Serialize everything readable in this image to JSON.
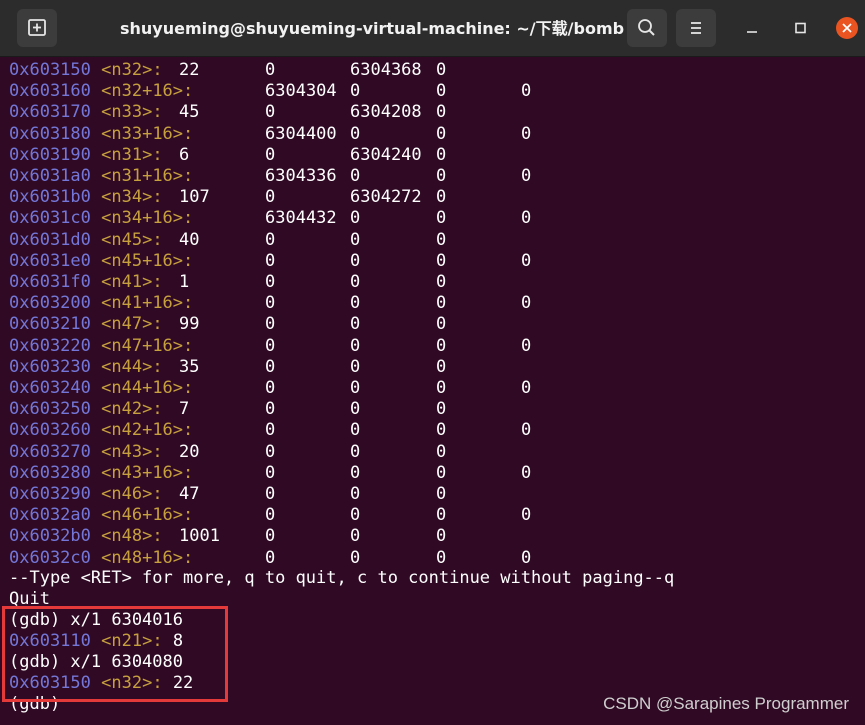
{
  "window": {
    "title": "shuyueming@shuyueming-virtual-machine: ~/下载/bomb",
    "icons": {
      "new_tab": "new-tab-icon",
      "search": "search-icon",
      "menu": "hamburger-menu-icon",
      "minimize": "minimize-icon",
      "maximize": "maximize-icon",
      "close": "close-icon"
    },
    "colors": {
      "background": "#300a24",
      "address": "#7477d9",
      "symbol": "#c7a03e",
      "text": "#ffffff",
      "close_button": "#e95420",
      "highlight_border": "#e43a3a"
    }
  },
  "memory_rows": [
    {
      "addr": "0x603150",
      "sym": "<n32>:",
      "v1": "22",
      "v2": "0",
      "v3": "6304368",
      "v4": "0",
      "v5": ""
    },
    {
      "addr": "0x603160",
      "sym": "<n32+16>:",
      "v1": "",
      "v2": "6304304",
      "v3": "0",
      "v4": "0",
      "v5": "0"
    },
    {
      "addr": "0x603170",
      "sym": "<n33>:",
      "v1": "45",
      "v2": "0",
      "v3": "6304208",
      "v4": "0",
      "v5": ""
    },
    {
      "addr": "0x603180",
      "sym": "<n33+16>:",
      "v1": "",
      "v2": "6304400",
      "v3": "0",
      "v4": "0",
      "v5": "0"
    },
    {
      "addr": "0x603190",
      "sym": "<n31>:",
      "v1": "6",
      "v2": "0",
      "v3": "6304240",
      "v4": "0",
      "v5": ""
    },
    {
      "addr": "0x6031a0",
      "sym": "<n31+16>:",
      "v1": "",
      "v2": "6304336",
      "v3": "0",
      "v4": "0",
      "v5": "0"
    },
    {
      "addr": "0x6031b0",
      "sym": "<n34>:",
      "v1": "107",
      "v2": "0",
      "v3": "6304272",
      "v4": "0",
      "v5": ""
    },
    {
      "addr": "0x6031c0",
      "sym": "<n34+16>:",
      "v1": "",
      "v2": "6304432",
      "v3": "0",
      "v4": "0",
      "v5": "0"
    },
    {
      "addr": "0x6031d0",
      "sym": "<n45>:",
      "v1": "40",
      "v2": "0",
      "v3": "0",
      "v4": "0",
      "v5": ""
    },
    {
      "addr": "0x6031e0",
      "sym": "<n45+16>:",
      "v1": "",
      "v2": "0",
      "v3": "0",
      "v4": "0",
      "v5": "0"
    },
    {
      "addr": "0x6031f0",
      "sym": "<n41>:",
      "v1": "1",
      "v2": "0",
      "v3": "0",
      "v4": "0",
      "v5": ""
    },
    {
      "addr": "0x603200",
      "sym": "<n41+16>:",
      "v1": "",
      "v2": "0",
      "v3": "0",
      "v4": "0",
      "v5": "0"
    },
    {
      "addr": "0x603210",
      "sym": "<n47>:",
      "v1": "99",
      "v2": "0",
      "v3": "0",
      "v4": "0",
      "v5": ""
    },
    {
      "addr": "0x603220",
      "sym": "<n47+16>:",
      "v1": "",
      "v2": "0",
      "v3": "0",
      "v4": "0",
      "v5": "0"
    },
    {
      "addr": "0x603230",
      "sym": "<n44>:",
      "v1": "35",
      "v2": "0",
      "v3": "0",
      "v4": "0",
      "v5": ""
    },
    {
      "addr": "0x603240",
      "sym": "<n44+16>:",
      "v1": "",
      "v2": "0",
      "v3": "0",
      "v4": "0",
      "v5": "0"
    },
    {
      "addr": "0x603250",
      "sym": "<n42>:",
      "v1": "7",
      "v2": "0",
      "v3": "0",
      "v4": "0",
      "v5": ""
    },
    {
      "addr": "0x603260",
      "sym": "<n42+16>:",
      "v1": "",
      "v2": "0",
      "v3": "0",
      "v4": "0",
      "v5": "0"
    },
    {
      "addr": "0x603270",
      "sym": "<n43>:",
      "v1": "20",
      "v2": "0",
      "v3": "0",
      "v4": "0",
      "v5": ""
    },
    {
      "addr": "0x603280",
      "sym": "<n43+16>:",
      "v1": "",
      "v2": "0",
      "v3": "0",
      "v4": "0",
      "v5": "0"
    },
    {
      "addr": "0x603290",
      "sym": "<n46>:",
      "v1": "47",
      "v2": "0",
      "v3": "0",
      "v4": "0",
      "v5": ""
    },
    {
      "addr": "0x6032a0",
      "sym": "<n46+16>:",
      "v1": "",
      "v2": "0",
      "v3": "0",
      "v4": "0",
      "v5": "0"
    },
    {
      "addr": "0x6032b0",
      "sym": "<n48>:",
      "v1": "1001",
      "v2": "0",
      "v3": "0",
      "v4": "0",
      "v5": ""
    },
    {
      "addr": "0x6032c0",
      "sym": "<n48+16>:",
      "v1": "",
      "v2": "0",
      "v3": "0",
      "v4": "0",
      "v5": "0"
    }
  ],
  "pager_prompt": "--Type <RET> for more, q to quit, c to continue without paging--q",
  "quit_text": "Quit",
  "commands": [
    {
      "prompt": "(gdb) x/1 6304016",
      "addr": "0x603110",
      "sym": "<n21>:",
      "value": "8"
    },
    {
      "prompt": "(gdb) x/1 6304080",
      "addr": "0x603150",
      "sym": "<n32>:",
      "value": "22"
    }
  ],
  "final_prompt": "(gdb)",
  "watermark": "CSDN @Sarapines Programmer"
}
